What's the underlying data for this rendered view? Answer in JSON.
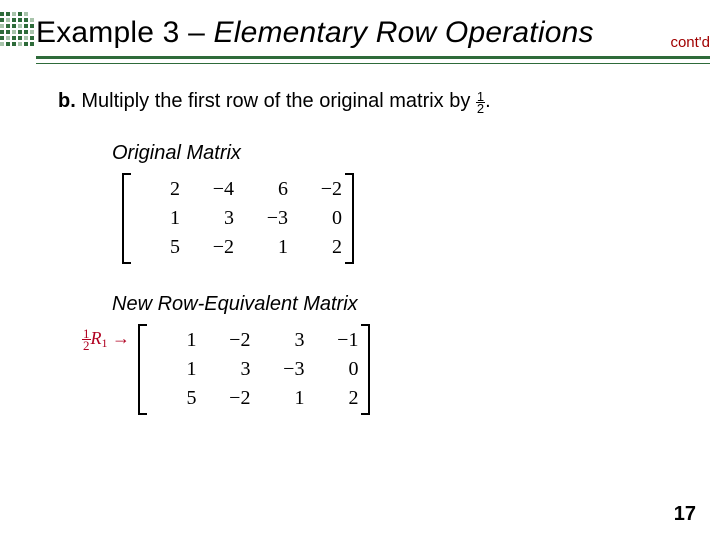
{
  "header": {
    "title_plain": "Example 3 – ",
    "title_italic": "Elementary Row Operations",
    "contd": "cont'd"
  },
  "instruction": {
    "label": "b.",
    "text_before": " Multiply the first row of the original matrix by ",
    "frac_num": "1",
    "frac_den": "2",
    "text_after": "."
  },
  "section1": {
    "heading": "Original Matrix",
    "rows": [
      [
        "2",
        "−4",
        "6",
        "−2"
      ],
      [
        "1",
        "3",
        "−3",
        "0"
      ],
      [
        "5",
        "−2",
        "1",
        "2"
      ]
    ]
  },
  "section2": {
    "heading": "New Row-Equivalent Matrix",
    "op_frac_num": "1",
    "op_frac_den": "2",
    "op_var": "R",
    "op_sub": "1",
    "op_arrow": "→",
    "rows": [
      [
        "1",
        "−2",
        "3",
        "−1"
      ],
      [
        "1",
        "3",
        "−3",
        "0"
      ],
      [
        "5",
        "−2",
        "1",
        "2"
      ]
    ]
  },
  "page": "17"
}
